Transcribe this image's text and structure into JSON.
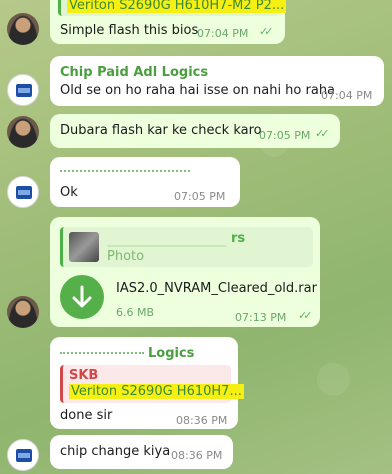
{
  "messages": [
    {
      "reply_quote": "Veriton S2690G H610H7-M2 P2...",
      "text": "Simple flash this bios",
      "time": "07:04 PM"
    },
    {
      "sender": "Chip Paid Adl Logics",
      "text": "Old  se on ho raha hai isse on nahi ho raha",
      "time": "07:04 PM"
    },
    {
      "text": "Dubara flash kar ke check karo",
      "time": "07:05 PM"
    },
    {
      "text": "Ok",
      "time": "07:05 PM"
    },
    {
      "reply_quote_tail": "rs",
      "reply_subtitle": "Photo",
      "file_name": "IAS2.0_NVRAM_Cleared_old.rar",
      "file_size": "6.6 MB",
      "time": "07:13 PM"
    },
    {
      "sender_partial": "Logics",
      "reply_sender": "SKB",
      "reply_quote": "Veriton S2690G H610H7...",
      "text": "done sir",
      "time": "08:36 PM"
    },
    {
      "text": "chip change kiya",
      "time": "08:36 PM"
    }
  ],
  "icons": {
    "ticks": "double-check-icon",
    "download": "download-arrow-icon"
  },
  "colors": {
    "sender": "#4a9e3e",
    "outgoing_bubble": "#eeffde",
    "highlight": "#f6ef13",
    "download": "#55b04a"
  }
}
